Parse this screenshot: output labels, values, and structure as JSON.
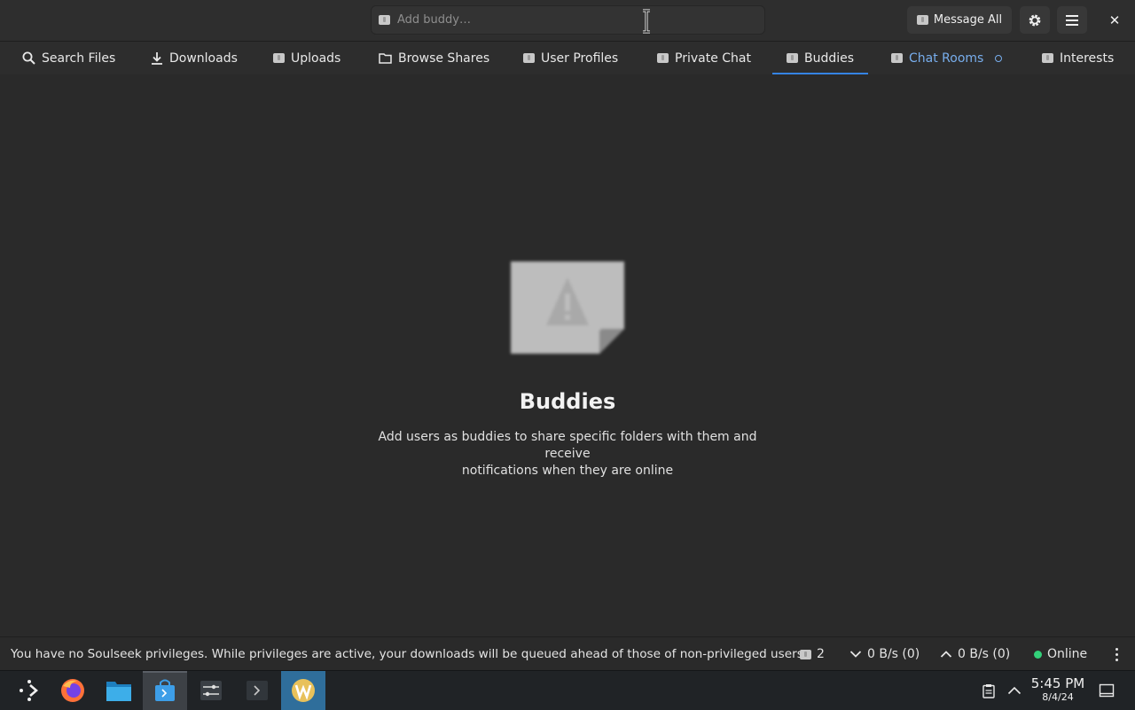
{
  "header": {
    "add_buddy_placeholder": "Add buddy…",
    "message_all_label": "Message All"
  },
  "tabs": [
    {
      "label": "Search Files"
    },
    {
      "label": "Downloads"
    },
    {
      "label": "Uploads"
    },
    {
      "label": "Browse Shares"
    },
    {
      "label": "User Profiles"
    },
    {
      "label": "Private Chat"
    },
    {
      "label": "Buddies",
      "active": true
    },
    {
      "label": "Chat Rooms",
      "highlighted": true
    },
    {
      "label": "Interests"
    }
  ],
  "main": {
    "title": "Buddies",
    "description_line1": "Add users as buddies to share specific folders with them and receive",
    "description_line2": "notifications when they are online"
  },
  "statusbar": {
    "message": "You have no Soulseek privileges. While privileges are active, your downloads will be queued ahead of those of non-privileged users.",
    "user_count": "2",
    "download_speed": "0 B/s (0)",
    "upload_speed": "0 B/s (0)",
    "connection_status": "Online"
  },
  "taskbar": {
    "time": "5:45 PM",
    "date": "8/4/24"
  },
  "colors": {
    "accent": "#3584e4",
    "online": "#33d17a",
    "highlight_tab": "#78aeed"
  }
}
